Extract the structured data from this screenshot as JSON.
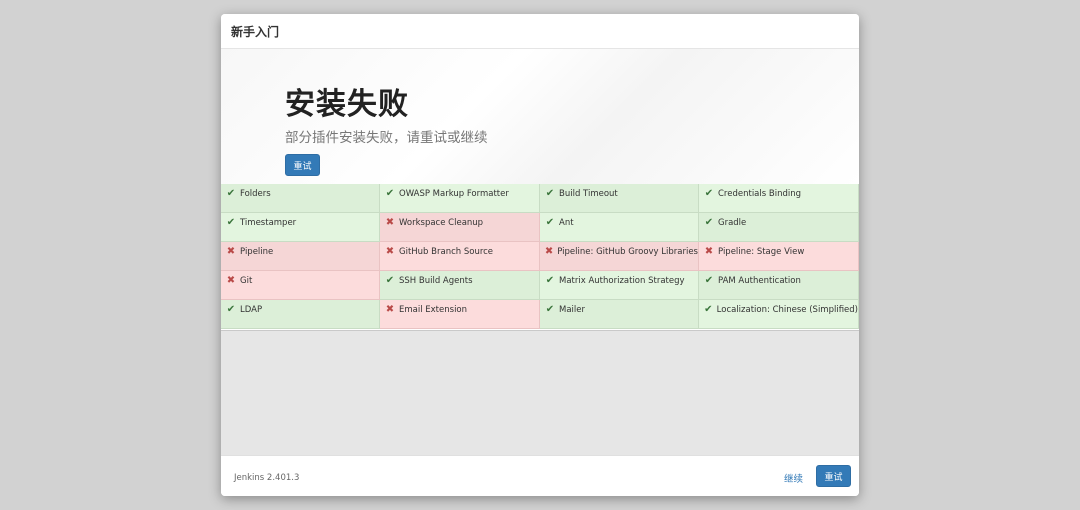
{
  "dialog": {
    "title": "新手入门"
  },
  "hero": {
    "title": "安装失败",
    "subtitle": "部分插件安装失败，请重试或继续",
    "retry_label": "重试"
  },
  "plugins": [
    {
      "name": "Folders",
      "status": "success"
    },
    {
      "name": "OWASP Markup Formatter",
      "status": "success"
    },
    {
      "name": "Build Timeout",
      "status": "success"
    },
    {
      "name": "Credentials Binding",
      "status": "success"
    },
    {
      "name": "Timestamper",
      "status": "success"
    },
    {
      "name": "Workspace Cleanup",
      "status": "failed"
    },
    {
      "name": "Ant",
      "status": "success"
    },
    {
      "name": "Gradle",
      "status": "success"
    },
    {
      "name": "Pipeline",
      "status": "failed"
    },
    {
      "name": "GitHub Branch Source",
      "status": "failed"
    },
    {
      "name": "Pipeline: GitHub Groovy Libraries",
      "status": "failed"
    },
    {
      "name": "Pipeline: Stage View",
      "status": "failed"
    },
    {
      "name": "Git",
      "status": "failed"
    },
    {
      "name": "SSH Build Agents",
      "status": "success"
    },
    {
      "name": "Matrix Authorization Strategy",
      "status": "success"
    },
    {
      "name": "PAM Authentication",
      "status": "success"
    },
    {
      "name": "LDAP",
      "status": "success"
    },
    {
      "name": "Email Extension",
      "status": "failed"
    },
    {
      "name": "Mailer",
      "status": "success"
    },
    {
      "name": "Localization: Chinese (Simplified)",
      "status": "success"
    }
  ],
  "icons": {
    "success": "check-icon",
    "failed": "cross-icon"
  },
  "colors": {
    "primary": "#337ab7",
    "success_bg": "#dcefd8",
    "failed_bg": "#f5d6d6",
    "success_mark": "#3c763d",
    "failed_mark": "#b94a48"
  },
  "footer": {
    "version": "Jenkins 2.401.3",
    "continue_label": "继续",
    "retry_label": "重试"
  }
}
